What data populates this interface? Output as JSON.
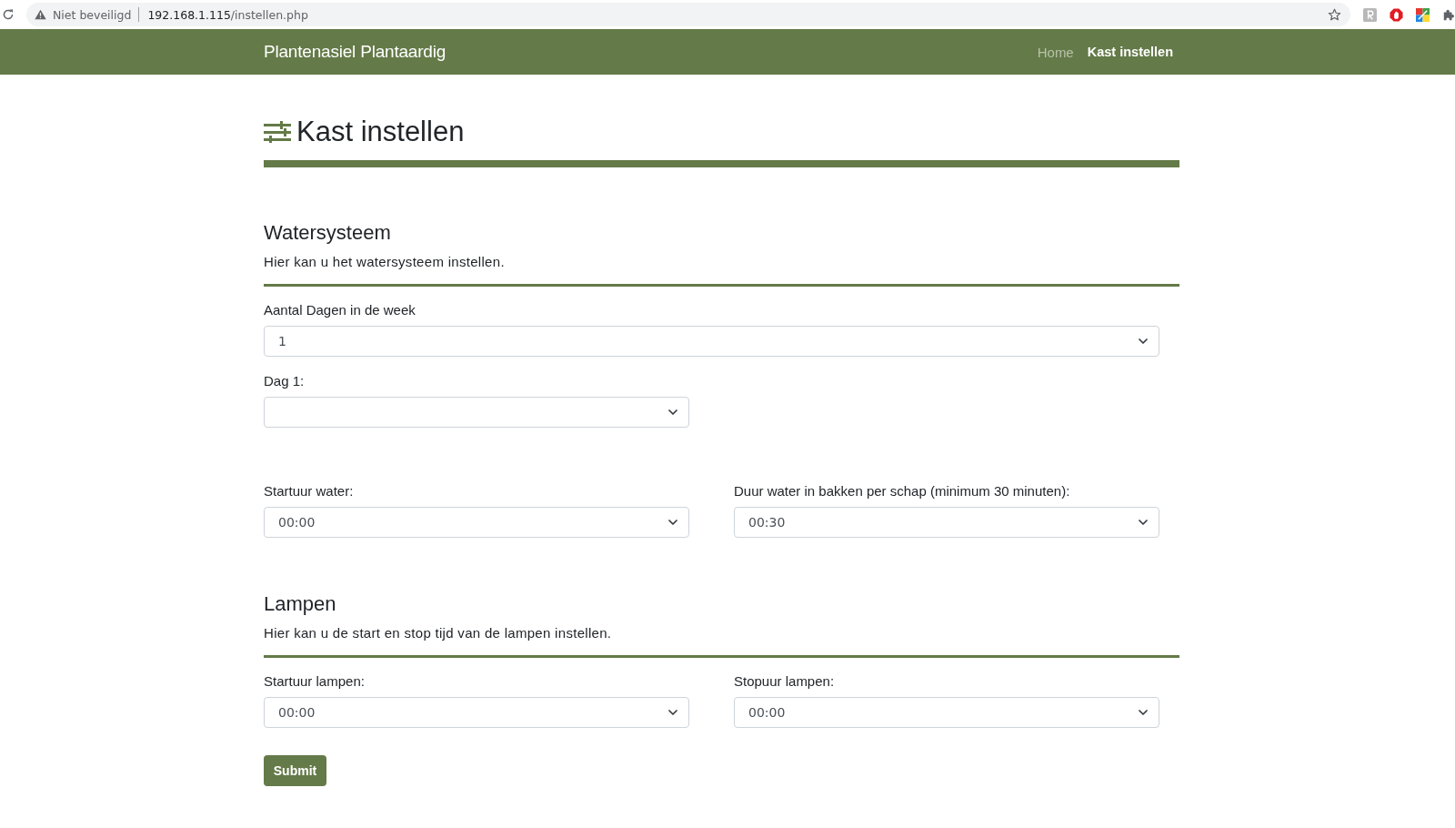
{
  "browser": {
    "security_label": "Niet beveiligd",
    "url_host": "192.168.1.115",
    "url_path": "/instellen.php"
  },
  "navbar": {
    "brand": "Plantenasiel Plantaardig",
    "links": [
      {
        "label": "Home",
        "selected": false
      },
      {
        "label": "Kast instellen",
        "selected": true
      }
    ]
  },
  "page": {
    "title": "Kast instellen"
  },
  "water_system": {
    "title": "Watersysteem",
    "description": "Hier kan u het watersysteem instellen.",
    "days_per_week": {
      "label": "Aantal Dagen in de week",
      "value": "1"
    },
    "days": [
      {
        "label": "Dag 1:"
      }
    ],
    "start_time": {
      "label": "Startuur water:",
      "value": "00:00"
    },
    "duration": {
      "label": "Duur water in bakken per schap (minimum 30 minuten):",
      "value": "00:30"
    }
  },
  "lamps": {
    "title": "Lampen",
    "description": "Hier kan u de start en stop tijd van de lampen instellen.",
    "start_time": {
      "label": "Startuur lampen:",
      "value": "00:00"
    },
    "stop_time": {
      "label": "Stopuur lampen:",
      "value": "00:00"
    }
  },
  "submit_button": "Submit"
}
